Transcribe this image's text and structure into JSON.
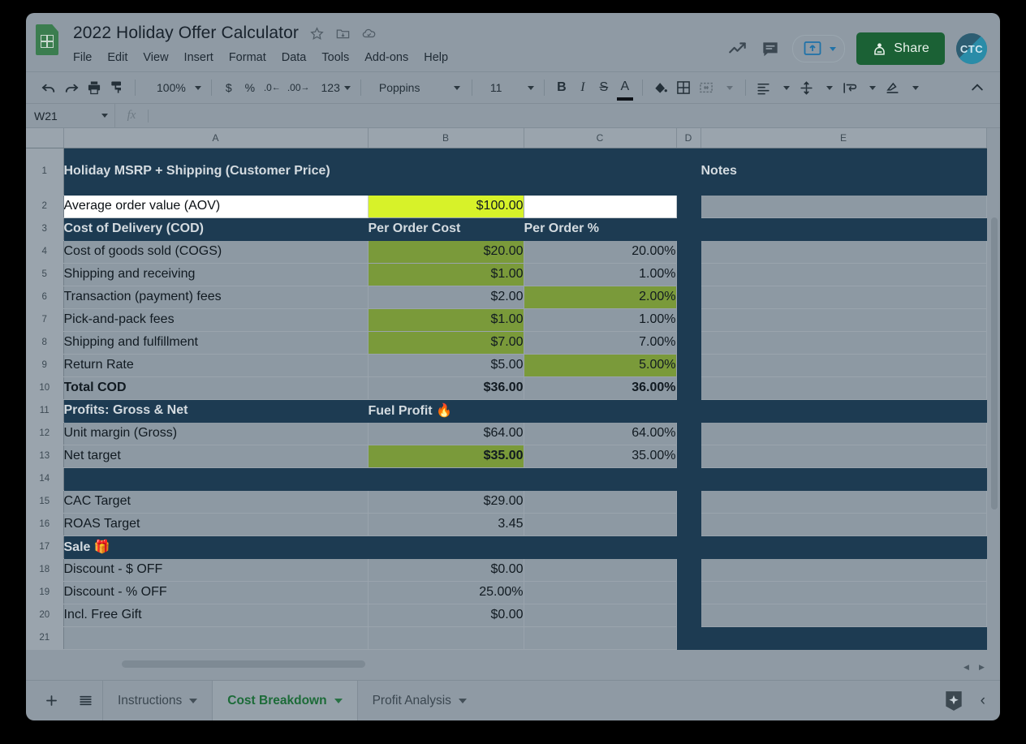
{
  "app": {
    "doc_title": "2022 Holiday Offer Calculator",
    "logo_name": "google-sheets-logo",
    "menu": [
      "File",
      "Edit",
      "View",
      "Insert",
      "Format",
      "Data",
      "Tools",
      "Add-ons",
      "Help"
    ],
    "title_icons": [
      "star-icon",
      "move-to-folder-icon",
      "cloud-saved-icon"
    ],
    "share_label": "Share",
    "avatar_initials": "CTC"
  },
  "toolbar": {
    "zoom": "100%",
    "currency": "$",
    "percent": "%",
    "decrease_decimal": ".0",
    "increase_decimal": ".00",
    "number_format": "123",
    "font": "Poppins",
    "font_size": "11",
    "bold": "B",
    "italic": "I",
    "strikethrough": "S",
    "text_color": "A",
    "icons": [
      "undo-icon",
      "redo-icon",
      "print-icon",
      "paint-format-icon",
      "fill-color-icon",
      "borders-icon",
      "merge-cells-icon",
      "horizontal-align-icon",
      "vertical-align-icon",
      "text-wrap-icon",
      "text-rotation-icon",
      "collapse-toolbar-icon"
    ]
  },
  "formula_bar": {
    "name_box": "W21",
    "fx_label": "fx",
    "formula_value": ""
  },
  "grid": {
    "columns": [
      "A",
      "B",
      "C",
      "D",
      "E"
    ],
    "rows": [
      {
        "n": "1",
        "type": "header-tall",
        "a": "Holiday MSRP + Shipping\n(Customer Price)",
        "b": "",
        "c": "",
        "e": "Notes"
      },
      {
        "n": "2",
        "type": "input",
        "a": "Average order value (AOV)",
        "b": "$100.00",
        "c": "",
        "e": ""
      },
      {
        "n": "3",
        "type": "header",
        "a": "Cost of Delivery (COD)",
        "b": "Per Order Cost",
        "c": "Per Order %",
        "e": ""
      },
      {
        "n": "4",
        "type": "data",
        "a": "Cost of goods sold (COGS)",
        "b": "$20.00",
        "c": "20.00%",
        "e": "",
        "hl": "b"
      },
      {
        "n": "5",
        "type": "data",
        "a": "Shipping and receiving",
        "b": "$1.00",
        "c": "1.00%",
        "e": "",
        "hl": "b"
      },
      {
        "n": "6",
        "type": "data",
        "a": "Transaction (payment) fees",
        "b": "$2.00",
        "c": "2.00%",
        "e": "",
        "hl": "c"
      },
      {
        "n": "7",
        "type": "data",
        "a": "Pick-and-pack fees",
        "b": "$1.00",
        "c": "1.00%",
        "e": "",
        "hl": "b"
      },
      {
        "n": "8",
        "type": "data",
        "a": "Shipping and fulfillment",
        "b": "$7.00",
        "c": "7.00%",
        "e": "",
        "hl": "b"
      },
      {
        "n": "9",
        "type": "data",
        "a": "Return Rate",
        "b": "$5.00",
        "c": "5.00%",
        "e": "",
        "hl": "c"
      },
      {
        "n": "10",
        "type": "total",
        "a": "Total COD",
        "b": "$36.00",
        "c": "36.00%",
        "e": ""
      },
      {
        "n": "11",
        "type": "header",
        "a": "Profits: Gross & Net",
        "b": "Fuel Profit 🔥",
        "c": "",
        "e": ""
      },
      {
        "n": "12",
        "type": "data",
        "a": "Unit margin (Gross)",
        "b": "$64.00",
        "c": "64.00%",
        "e": ""
      },
      {
        "n": "13",
        "type": "data",
        "a": "Net target",
        "b": "$35.00",
        "c": "35.00%",
        "e": "",
        "hl": "b",
        "bold_b": true
      },
      {
        "n": "14",
        "type": "spacer",
        "a": "",
        "b": "",
        "c": "",
        "e": ""
      },
      {
        "n": "15",
        "type": "data-nc",
        "a": "CAC Target",
        "b": "$29.00",
        "c": "",
        "e": ""
      },
      {
        "n": "16",
        "type": "data-nc",
        "a": "ROAS Target",
        "b": "3.45",
        "c": "",
        "e": ""
      },
      {
        "n": "17",
        "type": "header",
        "a": "Sale 🎁",
        "b": "",
        "c": "",
        "e": ""
      },
      {
        "n": "18",
        "type": "data-nc",
        "a": "Discount - $ OFF",
        "b": "$0.00",
        "c": "",
        "e": ""
      },
      {
        "n": "19",
        "type": "data-nc",
        "a": "Discount - % OFF",
        "b": "25.00%",
        "c": "",
        "e": ""
      },
      {
        "n": "20",
        "type": "data-nc",
        "a": "Incl. Free Gift",
        "b": "$0.00",
        "c": "",
        "e": ""
      },
      {
        "n": "21",
        "type": "empty",
        "a": "",
        "b": "",
        "c": "",
        "e": ""
      }
    ]
  },
  "sheet_tabs": {
    "add_label": "add-sheet",
    "all_sheets_label": "all-sheets",
    "tabs": [
      {
        "label": "Instructions",
        "active": false
      },
      {
        "label": "Cost Breakdown",
        "active": true
      },
      {
        "label": "Profit Analysis",
        "active": false
      }
    ]
  },
  "colors": {
    "navy": "#1d3b52",
    "green": "#7a9a3a",
    "yellow": "#d7f229",
    "cell_bg": "#8d99a3",
    "share_green": "#1b6135",
    "active_tab_green": "#1c6b38"
  }
}
